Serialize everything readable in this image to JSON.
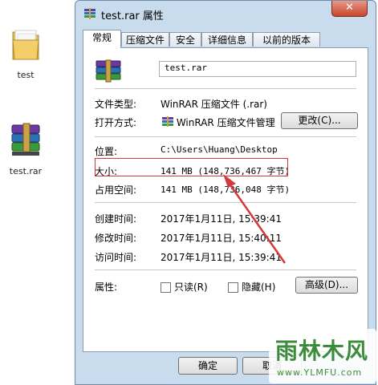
{
  "desktop": {
    "icons": [
      {
        "label": "test"
      },
      {
        "label": "test.rar"
      }
    ]
  },
  "window": {
    "title": "test.rar 属性",
    "close_label": "✕",
    "tabs": [
      "常规",
      "压缩文件",
      "安全",
      "详细信息",
      "以前的版本"
    ],
    "active_tab": "常规"
  },
  "general": {
    "filename": "test.rar",
    "file_type_label": "文件类型:",
    "file_type_value": "WinRAR 压缩文件 (.rar)",
    "opens_with_label": "打开方式:",
    "opens_with_value": "WinRAR 压缩文件管理",
    "change_button": "更改(C)...",
    "location_label": "位置:",
    "location_value": "C:\\Users\\Huang\\Desktop",
    "size_label": "大小:",
    "size_value": "141 MB (148,736,467 字节)",
    "disk_size_label": "占用空间:",
    "disk_size_value": "141 MB (148,736,048 字节)",
    "created_label": "创建时间:",
    "created_value": "2017年1月11日, 15:39:41",
    "modified_label": "修改时间:",
    "modified_value": "2017年1月11日, 15:40:11",
    "accessed_label": "访问时间:",
    "accessed_value": "2017年1月11日, 15:39:41",
    "attributes_label": "属性:",
    "readonly_label": "只读(R)",
    "hidden_label": "隐藏(H)",
    "advanced_button": "高级(D)..."
  },
  "footer": {
    "ok_button": "确定",
    "cancel_button": "取消"
  },
  "watermark": {
    "brand": "雨林木风",
    "url": "www.YLMFU.com"
  },
  "colors": {
    "highlight": "#d43a3a",
    "window_frame": "#c9dcee"
  }
}
